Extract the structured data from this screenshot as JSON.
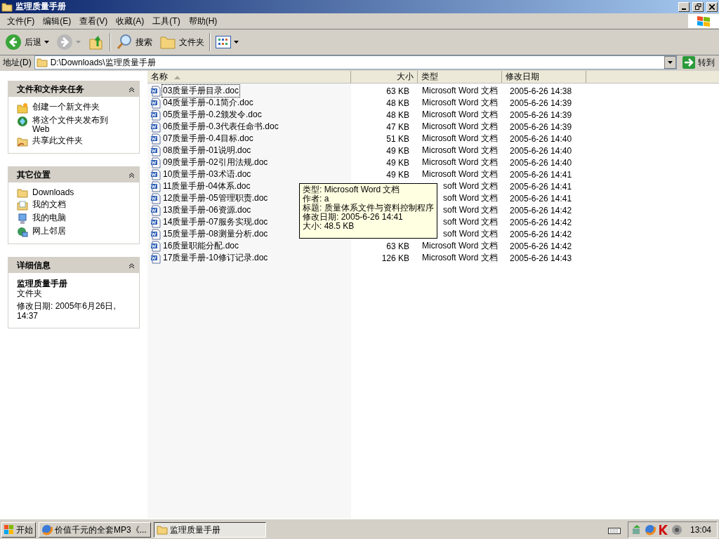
{
  "window": {
    "title": "监理质量手册"
  },
  "menu": [
    "文件(F)",
    "编辑(E)",
    "查看(V)",
    "收藏(A)",
    "工具(T)",
    "帮助(H)"
  ],
  "toolbar": {
    "back": "后退",
    "search": "搜索",
    "folders": "文件夹"
  },
  "address": {
    "label": "地址(D)",
    "value": "D:\\Downloads\\监理质量手册",
    "go": "转到"
  },
  "tasks": {
    "title": "文件和文件夹任务",
    "items": [
      {
        "kind": "newfolder",
        "label": "创建一个新文件夹"
      },
      {
        "kind": "web",
        "label": "将这个文件夹发布到 Web"
      },
      {
        "kind": "share",
        "label": "共享此文件夹"
      }
    ]
  },
  "places": {
    "title": "其它位置",
    "items": [
      {
        "kind": "folder",
        "label": "Downloads"
      },
      {
        "kind": "docs",
        "label": "我的文档"
      },
      {
        "kind": "computer",
        "label": "我的电脑"
      },
      {
        "kind": "network",
        "label": "网上邻居"
      }
    ]
  },
  "details": {
    "title": "详细信息",
    "name": "监理质量手册",
    "type": "文件夹",
    "modified": "修改日期: 2005年6月26日, 14:37"
  },
  "columns": [
    "名称",
    "大小",
    "类型",
    "修改日期"
  ],
  "files": [
    {
      "name": "03质量手册目录.doc",
      "size": "63 KB",
      "type": "Microsoft Word 文档",
      "date": "2005-6-26 14:38",
      "selected": true,
      "kind": "full"
    },
    {
      "name": "04质量手册-0.1简介.doc",
      "size": "48 KB",
      "type": "Microsoft Word 文档",
      "date": "2005-6-26 14:39",
      "selected": false,
      "kind": "full"
    },
    {
      "name": "05质量手册-0.2颁发令.doc",
      "size": "48 KB",
      "type": "Microsoft Word 文档",
      "date": "2005-6-26 14:39",
      "selected": false,
      "kind": "full"
    },
    {
      "name": "06质量手册-0.3代表任命书.doc",
      "size": "47 KB",
      "type": "Microsoft Word 文档",
      "date": "2005-6-26 14:39",
      "selected": false,
      "kind": "full"
    },
    {
      "name": "07质量手册-0.4目标.doc",
      "size": "51 KB",
      "type": "Microsoft Word 文档",
      "date": "2005-6-26 14:40",
      "selected": false,
      "kind": "full"
    },
    {
      "name": "08质量手册-01说明.doc",
      "size": "49 KB",
      "type": "Microsoft Word 文档",
      "date": "2005-6-26 14:40",
      "selected": false,
      "kind": "full"
    },
    {
      "name": "09质量手册-02引用法规.doc",
      "size": "49 KB",
      "type": "Microsoft Word 文档",
      "date": "2005-6-26 14:40",
      "selected": false,
      "kind": "full"
    },
    {
      "name": "10质量手册-03术语.doc",
      "size": "49 KB",
      "type": "Microsoft Word 文档",
      "date": "2005-6-26 14:41",
      "selected": false,
      "kind": "full"
    },
    {
      "name": "11质量手册-04体系.doc",
      "type": "soft Word 文档",
      "date": "2005-6-26 14:41",
      "selected": false,
      "kind": "covered"
    },
    {
      "name": "12质量手册-05管理职责.doc",
      "type": "soft Word 文档",
      "date": "2005-6-26 14:41",
      "selected": false,
      "kind": "covered"
    },
    {
      "name": "13质量手册-06资源.doc",
      "type": "soft Word 文档",
      "date": "2005-6-26 14:42",
      "selected": false,
      "kind": "covered"
    },
    {
      "name": "14质量手册-07服务实现.doc",
      "type": "soft Word 文档",
      "date": "2005-6-26 14:42",
      "selected": false,
      "kind": "covered"
    },
    {
      "name": "15质量手册-08测量分析.doc",
      "type": "soft Word 文档",
      "date": "2005-6-26 14:42",
      "selected": false,
      "kind": "covered"
    },
    {
      "name": "16质量职能分配.doc",
      "size": "63 KB",
      "type": "Microsoft Word 文档",
      "date": "2005-6-26 14:42",
      "selected": false,
      "kind": "full"
    },
    {
      "name": "17质量手册-10修订记录.doc",
      "size": "126 KB",
      "type": "Microsoft Word 文档",
      "date": "2005-6-26 14:43",
      "selected": false,
      "kind": "full"
    }
  ],
  "tooltip": [
    "类型: Microsoft Word 文档",
    "作者: a",
    "标题: 质量体系文件与资料控制程序",
    "修改日期: 2005-6-26 14:41",
    "大小: 48.5 KB"
  ],
  "taskbar": {
    "start": "开始",
    "tasks": [
      {
        "label": "价值千元的全套MP3《...",
        "kind": "browser",
        "selected": false
      },
      {
        "label": "监理质量手册",
        "kind": "folder",
        "selected": true
      }
    ],
    "clock": "13:04"
  }
}
